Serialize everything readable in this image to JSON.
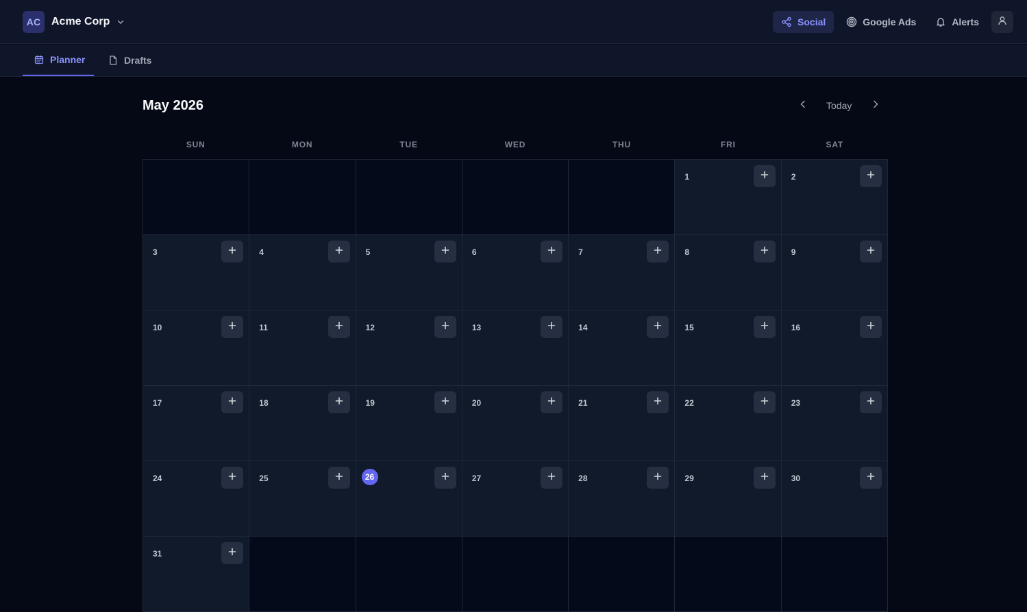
{
  "org": {
    "initials": "AC",
    "name": "Acme Corp",
    "dropdown_icon": "chevron-down-icon"
  },
  "header": {
    "buttons": [
      {
        "label": "Social",
        "icon": "share-icon",
        "active": true
      },
      {
        "label": "Google Ads",
        "icon": "target-icon",
        "active": false
      },
      {
        "label": "Alerts",
        "icon": "bell-icon",
        "active": false
      }
    ],
    "user_icon": "user-icon"
  },
  "tabs": [
    {
      "label": "Planner",
      "icon": "calendar-icon",
      "active": true
    },
    {
      "label": "Drafts",
      "icon": "file-icon",
      "active": false
    }
  ],
  "calendar": {
    "month_label": "May 2026",
    "today_label": "Today",
    "weekdays": [
      "SUN",
      "MON",
      "TUE",
      "WED",
      "THU",
      "FRI",
      "SAT"
    ],
    "first_weekday_index": 5,
    "days_in_month": 31,
    "today": 26,
    "add_icon": "plus-icon"
  },
  "colors": {
    "accent": "#6366f1",
    "accent_text": "#8b92ff",
    "background": "#050916",
    "panel": "#0f1629",
    "cell": "#111a2b"
  }
}
